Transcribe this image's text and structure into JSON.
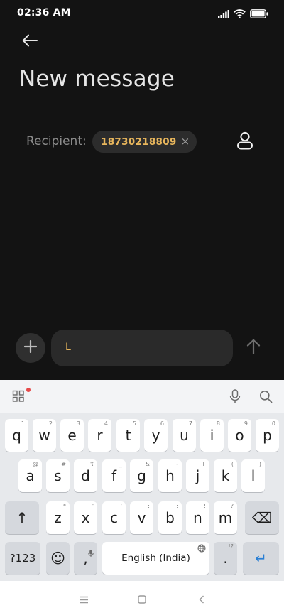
{
  "status_bar": {
    "time": "02:36 AM",
    "icons": [
      "signal-icon",
      "wifi-icon",
      "battery-icon"
    ]
  },
  "header": {
    "title": "New message",
    "back_icon": "back-arrow-icon"
  },
  "recipient": {
    "label": "Recipient:",
    "chip_number": "18730218809",
    "chip_remove_glyph": "×",
    "contact_icon": "person-icon"
  },
  "compose": {
    "attach_icon": "plus-icon",
    "message_value": "L",
    "send_icon": "send-arrow-icon"
  },
  "keyboard": {
    "toolbar_icons": [
      "grid-icon",
      "mic-icon",
      "search-icon"
    ],
    "rows": [
      [
        {
          "label": "q",
          "hint": "1"
        },
        {
          "label": "w",
          "hint": "2"
        },
        {
          "label": "e",
          "hint": "3"
        },
        {
          "label": "r",
          "hint": "4"
        },
        {
          "label": "t",
          "hint": "5"
        },
        {
          "label": "y",
          "hint": "6"
        },
        {
          "label": "u",
          "hint": "7"
        },
        {
          "label": "i",
          "hint": "8"
        },
        {
          "label": "o",
          "hint": "9"
        },
        {
          "label": "p",
          "hint": "0"
        }
      ],
      [
        {
          "label": "a",
          "hint": "@"
        },
        {
          "label": "s",
          "hint": "#"
        },
        {
          "label": "d",
          "hint": "₹"
        },
        {
          "label": "f",
          "hint": "_"
        },
        {
          "label": "g",
          "hint": "&"
        },
        {
          "label": "h",
          "hint": "-"
        },
        {
          "label": "j",
          "hint": "+"
        },
        {
          "label": "k",
          "hint": "("
        },
        {
          "label": "l",
          "hint": ")"
        }
      ],
      [
        {
          "label": "z",
          "hint": "*"
        },
        {
          "label": "x",
          "hint": "\""
        },
        {
          "label": "c",
          "hint": "'"
        },
        {
          "label": "v",
          "hint": ":"
        },
        {
          "label": "b",
          "hint": ";"
        },
        {
          "label": "n",
          "hint": "!"
        },
        {
          "label": "m",
          "hint": "?"
        }
      ]
    ],
    "shift_glyph": "↑",
    "backspace_glyph": "⌫",
    "symbols_label": "?123",
    "emoji_glyph": "☺",
    "comma_label": ",",
    "space_label": "English (India)",
    "period_label": ".",
    "period_hint": "!?",
    "enter_glyph": "↵",
    "accent_color": "#2a7fd4"
  },
  "nav_bar": {
    "icons": [
      "menu-icon",
      "home-square-icon",
      "back-chevron-icon"
    ]
  },
  "colors": {
    "background": "#131313",
    "accent": "#e8b65c"
  }
}
